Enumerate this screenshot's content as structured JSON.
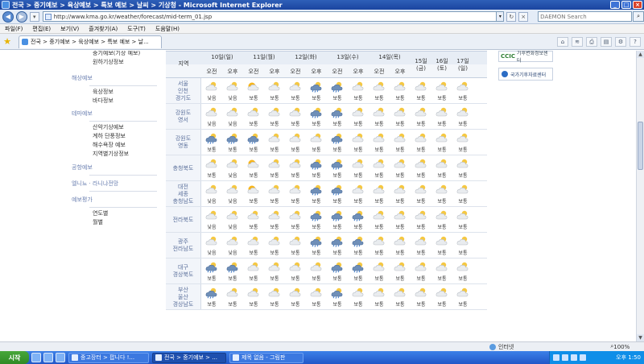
{
  "window": {
    "title": "전국 > 중기예보 > 육상예보 > 특보 예보 > 날씨 > 기상청 - Microsoft Internet Explorer"
  },
  "address": {
    "url": "http://www.kma.go.kr/weather/forecast/mid-term_01.jsp",
    "search_placeholder": "DAEMON Search"
  },
  "menu": [
    "파일(F)",
    "편집(E)",
    "보기(V)",
    "즐겨찾기(A)",
    "도구(T)",
    "도움말(H)"
  ],
  "tab": {
    "label": "전국 > 중기예보 > 육상예보 > 특보 예보 > 날..."
  },
  "sidebar": {
    "top_items": [
      "중기예보(기상 예보)",
      "원하기상정보"
    ],
    "sections": [
      {
        "head": "해상예보",
        "items": [
          "육상정보",
          "바다정보"
        ]
      },
      {
        "head": "테마예보",
        "items": [
          "산악기상예보",
          "계하 단풍정보",
          "해수욕장 예보",
          "지역별기상정보"
        ]
      },
      {
        "head": "공항예보",
        "items": []
      },
      {
        "head": "엘니뇨 · 라니냐전망",
        "items": []
      },
      {
        "head": "예보평가",
        "items": [
          "연도별",
          "월별"
        ]
      }
    ]
  },
  "forecast": {
    "region_header": "지역",
    "days": [
      {
        "label": "10일(일)",
        "split": true
      },
      {
        "label": "11일(월)",
        "split": true
      },
      {
        "label": "12일(화)",
        "split": true
      },
      {
        "label": "13일(수)",
        "split": true
      },
      {
        "label": "14일(목)",
        "split": true
      },
      {
        "label": "15일(금)",
        "split": false
      },
      {
        "label": "16일(토)",
        "split": false
      },
      {
        "label": "17일(일)",
        "split": false
      }
    ],
    "am_label": "오전",
    "pm_label": "오후",
    "regions": [
      {
        "name": "서울\n인천\n경기도",
        "cells": [
          [
            "cloudy",
            "낮음"
          ],
          [
            "cloudy",
            "낮음"
          ],
          [
            "sunny",
            "보통"
          ],
          [
            "cloudy",
            "보통"
          ],
          [
            "cloudy",
            "보통"
          ],
          [
            "rain",
            "보통"
          ],
          [
            "rain",
            "보통"
          ],
          [
            "cloudy",
            "보통"
          ],
          [
            "cloudy",
            "보통"
          ],
          [
            "cloudy",
            "보통"
          ],
          [
            "cloudy",
            "보통"
          ],
          [
            "cloudy",
            "보통"
          ],
          [
            "cloudy",
            "보통"
          ]
        ]
      },
      {
        "name": "강원도\n영서",
        "cells": [
          [
            "cloudy",
            "낮음"
          ],
          [
            "cloudy",
            "낮음"
          ],
          [
            "cloudy",
            "보통"
          ],
          [
            "cloudy",
            "보통"
          ],
          [
            "cloudy",
            "보통"
          ],
          [
            "rain",
            "보통"
          ],
          [
            "rain",
            "보통"
          ],
          [
            "cloudy",
            "보통"
          ],
          [
            "cloudy",
            "보통"
          ],
          [
            "cloudy",
            "보통"
          ],
          [
            "cloudy",
            "보통"
          ],
          [
            "cloudy",
            "보통"
          ],
          [
            "cloudy",
            "보통"
          ]
        ]
      },
      {
        "name": "강원도\n영동",
        "cells": [
          [
            "rain",
            "보통"
          ],
          [
            "rain",
            "보통"
          ],
          [
            "rain",
            "보통"
          ],
          [
            "cloudy",
            "보통"
          ],
          [
            "cloudy",
            "보통"
          ],
          [
            "cloudy",
            "보통"
          ],
          [
            "rain",
            "보통"
          ],
          [
            "cloudy",
            "보통"
          ],
          [
            "cloudy",
            "보통"
          ],
          [
            "cloudy",
            "보통"
          ],
          [
            "cloudy",
            "보통"
          ],
          [
            "cloudy",
            "보통"
          ],
          [
            "cloudy",
            "보통"
          ]
        ]
      },
      {
        "name": "충청북도",
        "cells": [
          [
            "cloudy",
            "보통"
          ],
          [
            "cloudy",
            "낮음"
          ],
          [
            "sunny",
            "보통"
          ],
          [
            "cloudy",
            "보통"
          ],
          [
            "cloudy",
            "보통"
          ],
          [
            "rain",
            "보통"
          ],
          [
            "rain",
            "보통"
          ],
          [
            "cloudy",
            "보통"
          ],
          [
            "cloudy",
            "보통"
          ],
          [
            "cloudy",
            "보통"
          ],
          [
            "cloudy",
            "보통"
          ],
          [
            "cloudy",
            "보통"
          ],
          [
            "cloudy",
            "보통"
          ]
        ]
      },
      {
        "name": "대전\n세종\n충청남도",
        "cells": [
          [
            "cloudy",
            "낮음"
          ],
          [
            "cloudy",
            "낮음"
          ],
          [
            "sunny",
            "보통"
          ],
          [
            "cloudy",
            "보통"
          ],
          [
            "cloudy",
            "보통"
          ],
          [
            "rain",
            "보통"
          ],
          [
            "rain",
            "보통"
          ],
          [
            "cloudy",
            "보통"
          ],
          [
            "cloudy",
            "보통"
          ],
          [
            "cloudy",
            "보통"
          ],
          [
            "cloudy",
            "보통"
          ],
          [
            "cloudy",
            "보통"
          ],
          [
            "cloudy",
            "보통"
          ]
        ]
      },
      {
        "name": "전라북도",
        "cells": [
          [
            "cloudy",
            "낮음"
          ],
          [
            "cloudy",
            "낮음"
          ],
          [
            "cloudy",
            "보통"
          ],
          [
            "cloudy",
            "보통"
          ],
          [
            "cloudy",
            "보통"
          ],
          [
            "rain",
            "보통"
          ],
          [
            "rain",
            "보통"
          ],
          [
            "rain",
            "보통"
          ],
          [
            "cloudy",
            "보통"
          ],
          [
            "cloudy",
            "보통"
          ],
          [
            "cloudy",
            "보통"
          ],
          [
            "cloudy",
            "보통"
          ],
          [
            "cloudy",
            "보통"
          ]
        ]
      },
      {
        "name": "광주\n전라남도",
        "cells": [
          [
            "cloudy",
            "낮음"
          ],
          [
            "cloudy",
            "낮음"
          ],
          [
            "cloudy",
            "보통"
          ],
          [
            "cloudy",
            "보통"
          ],
          [
            "cloudy",
            "보통"
          ],
          [
            "rain",
            "보통"
          ],
          [
            "rain",
            "보통"
          ],
          [
            "rain",
            "보통"
          ],
          [
            "cloudy",
            "보통"
          ],
          [
            "cloudy",
            "보통"
          ],
          [
            "cloudy",
            "보통"
          ],
          [
            "cloudy",
            "보통"
          ],
          [
            "cloudy",
            "보통"
          ]
        ]
      },
      {
        "name": "대구\n경상북도",
        "cells": [
          [
            "rain",
            "보통"
          ],
          [
            "rain",
            "보통"
          ],
          [
            "cloudy",
            "보통"
          ],
          [
            "cloudy",
            "보통"
          ],
          [
            "cloudy",
            "보통"
          ],
          [
            "cloudy",
            "보통"
          ],
          [
            "rain",
            "보통"
          ],
          [
            "rain",
            "보통"
          ],
          [
            "cloudy",
            "보통"
          ],
          [
            "cloudy",
            "보통"
          ],
          [
            "cloudy",
            "보통"
          ],
          [
            "cloudy",
            "보통"
          ],
          [
            "cloudy",
            "보통"
          ]
        ]
      },
      {
        "name": "부산\n울산\n경상남도",
        "cells": [
          [
            "rain",
            "보통"
          ],
          [
            "cloudy",
            "보통"
          ],
          [
            "cloudy",
            "보통"
          ],
          [
            "cloudy",
            "보통"
          ],
          [
            "cloudy",
            "보통"
          ],
          [
            "cloudy",
            "보통"
          ],
          [
            "rain",
            "보통"
          ],
          [
            "cloudy",
            "보통"
          ],
          [
            "cloudy",
            "보통"
          ],
          [
            "cloudy",
            "보통"
          ],
          [
            "cloudy",
            "보통"
          ],
          [
            "cloudy",
            "보통"
          ],
          [
            "cloudy",
            "보통"
          ]
        ]
      }
    ]
  },
  "logos": {
    "ccic_mark": "CCIC",
    "ccic_text": "기후변화정보센터",
    "nmc_text": "국가기후자료센터"
  },
  "status": {
    "zone": "인터넷",
    "zoom": "100%"
  },
  "taskbar": {
    "start_label": "시작",
    "tasks": [
      "중고장터 > 팝니다 !...",
      "전국 > 중기예보 > ...",
      "제목 없음 - 그림판"
    ],
    "clock": "오후 1:50"
  },
  "colors": {
    "titlebar": "#1b45a0",
    "sidebar_heading": "#6a7fb0",
    "region_text": "#5a6f9b"
  }
}
